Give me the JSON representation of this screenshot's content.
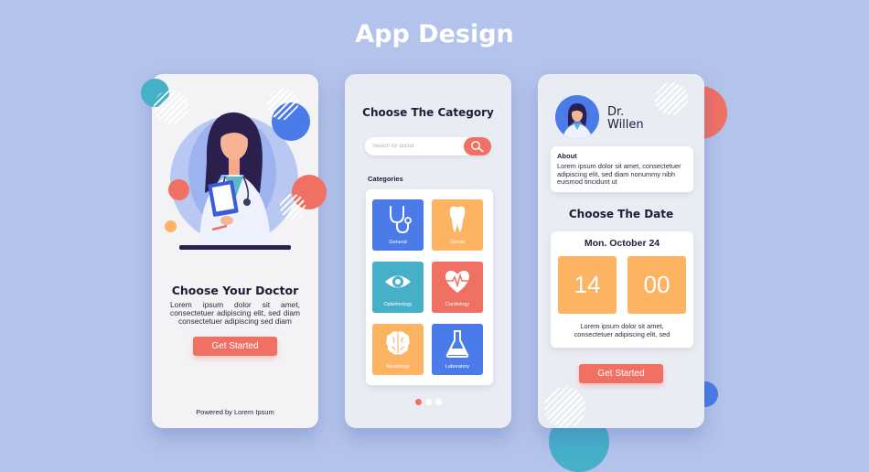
{
  "header": {
    "title": "App Design"
  },
  "screen1": {
    "title": "Choose Your Doctor",
    "body": "Lorem ipsum dolor sit amet, consectetuer adipiscing elit, sed diam consectetuer adipiscing sed diam",
    "button_label": "Get Started",
    "footer": "Powered by Lorem Ipsum"
  },
  "screen2": {
    "title": "Choose The Category",
    "search": {
      "placeholder": "Search for doctor",
      "value": ""
    },
    "categories_label": "Categories",
    "categories": [
      {
        "label": "General",
        "icon": "stethoscope-icon",
        "color": "#4a7be8"
      },
      {
        "label": "Dental",
        "icon": "tooth-icon",
        "color": "#fcb462"
      },
      {
        "label": "Optalmology",
        "icon": "eye-icon",
        "color": "#46b0c9"
      },
      {
        "label": "Cardiology",
        "icon": "heart-pulse-icon",
        "color": "#f07063"
      },
      {
        "label": "Neurology",
        "icon": "brain-icon",
        "color": "#fcb462"
      },
      {
        "label": "Laboratory",
        "icon": "flask-icon",
        "color": "#4a7be8"
      }
    ],
    "pagination": {
      "count": 3,
      "active": 1
    }
  },
  "screen3": {
    "doctor_name_line1": "Dr.",
    "doctor_name_line2": "Willen",
    "about_label": "About",
    "about_text": "Lorem ipsum dolor sit amet, consectetuer adipiscing elit, sed diam nonummy nibh euismod tincidunt ut",
    "choose_date_title": "Choose The Date",
    "date_label": "Mon. October 24",
    "hour": "14",
    "minute": "00",
    "date_note": "Lorem ipsum dolor sit amet, consectetuer adipiscing elit, sed",
    "button_label": "Get Started"
  },
  "colors": {
    "background": "#b3c3eb",
    "accent_coral": "#f07063",
    "accent_blue": "#4a7be8",
    "accent_orange": "#fcb462",
    "accent_teal": "#46b0c9",
    "text_dark": "#1d1d3a"
  }
}
